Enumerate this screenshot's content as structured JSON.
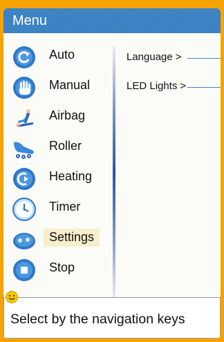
{
  "header": {
    "title": "Menu"
  },
  "menu": {
    "items": [
      {
        "label": "Auto",
        "icon": "auto-refresh-icon"
      },
      {
        "label": "Manual",
        "icon": "hand-icon"
      },
      {
        "label": "Airbag",
        "icon": "massage-chair-icon"
      },
      {
        "label": "Roller",
        "icon": "foot-roller-icon"
      },
      {
        "label": "Heating",
        "icon": "heating-icon"
      },
      {
        "label": "Timer",
        "icon": "clock-icon"
      },
      {
        "label": "Settings",
        "icon": "settings-icon",
        "selected": true
      },
      {
        "label": "Stop",
        "icon": "stop-icon"
      }
    ]
  },
  "submenu": {
    "items": [
      {
        "label": "Language",
        "arrow": ">"
      },
      {
        "label": "LED Lights",
        "arrow": ">"
      }
    ]
  },
  "hint": {
    "text": "Select by the navigation keys"
  },
  "colors": {
    "accent": "#3f86c7",
    "frame": "#f4a300",
    "selected": "#f8eecb"
  }
}
